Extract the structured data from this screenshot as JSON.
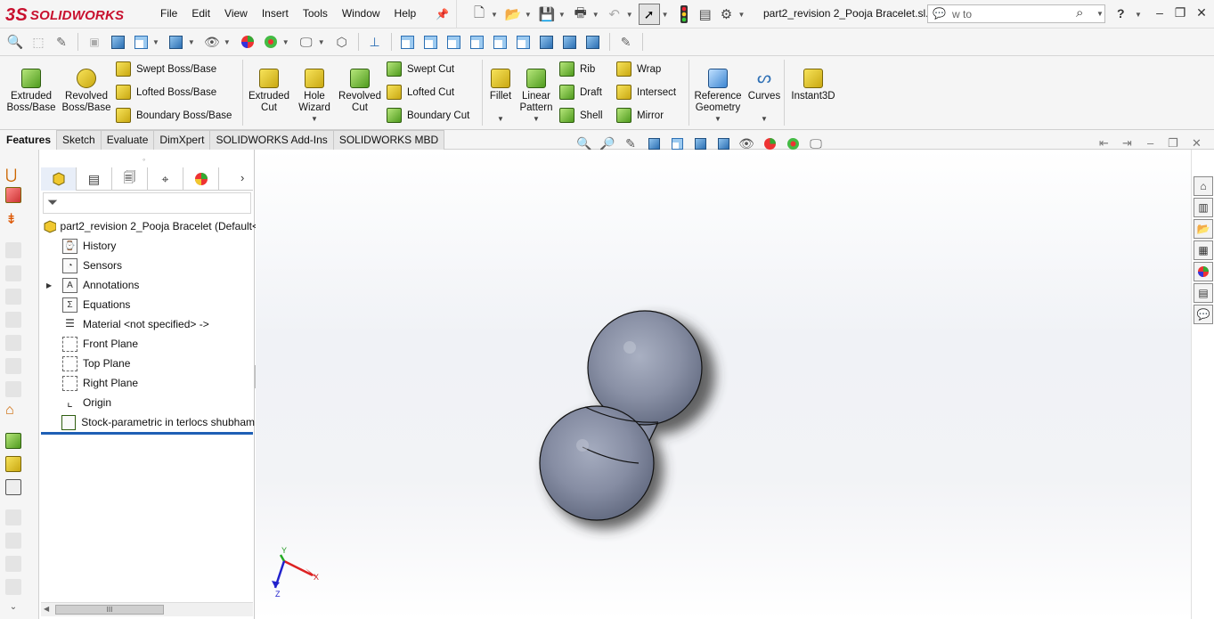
{
  "app": {
    "logo_prefix": "3S",
    "logo_text": "SOLIDWORKS"
  },
  "menu": [
    "File",
    "Edit",
    "View",
    "Insert",
    "Tools",
    "Window",
    "Help"
  ],
  "document_title": "part2_revision 2_Pooja Bracelet.sl...",
  "search": {
    "value": "w to"
  },
  "help_label": "?",
  "ribbon": {
    "extruded_boss": "Extruded Boss/Base",
    "revolved_boss": "Revolved Boss/Base",
    "swept_boss": "Swept Boss/Base",
    "lofted_boss": "Lofted Boss/Base",
    "boundary_boss": "Boundary Boss/Base",
    "extruded_cut": "Extruded Cut",
    "hole_wizard": "Hole Wizard",
    "revolved_cut": "Revolved Cut",
    "swept_cut": "Swept Cut",
    "lofted_cut": "Lofted Cut",
    "boundary_cut": "Boundary Cut",
    "fillet": "Fillet",
    "linear_pattern": "Linear Pattern",
    "rib": "Rib",
    "draft": "Draft",
    "shell": "Shell",
    "wrap": "Wrap",
    "intersect": "Intersect",
    "mirror": "Mirror",
    "reference_geometry": "Reference Geometry",
    "curves": "Curves",
    "instant3d": "Instant3D"
  },
  "tabs": [
    {
      "label": "Features",
      "active": true
    },
    {
      "label": "Sketch",
      "active": false
    },
    {
      "label": "Evaluate",
      "active": false
    },
    {
      "label": "DimXpert",
      "active": false
    },
    {
      "label": "SOLIDWORKS Add-Ins",
      "active": false
    },
    {
      "label": "SOLIDWORKS MBD",
      "active": false
    }
  ],
  "feature_tree": {
    "root": "part2_revision 2_Pooja Bracelet  (Default<",
    "items": [
      {
        "label": "History",
        "icon": "history-icon",
        "expandable": false
      },
      {
        "label": "Sensors",
        "icon": "sensors-icon",
        "expandable": false
      },
      {
        "label": "Annotations",
        "icon": "annotations-icon",
        "expandable": true
      },
      {
        "label": "Equations",
        "icon": "equations-icon",
        "expandable": false
      },
      {
        "label": "Material <not specified> ->",
        "icon": "material-icon",
        "expandable": false
      },
      {
        "label": "Front Plane",
        "icon": "plane-icon",
        "expandable": false
      },
      {
        "label": "Top Plane",
        "icon": "plane-icon",
        "expandable": false
      },
      {
        "label": "Right Plane",
        "icon": "plane-icon",
        "expandable": false
      },
      {
        "label": "Origin",
        "icon": "origin-icon",
        "expandable": false
      },
      {
        "label": "Stock-parametric in terlocs shubham",
        "icon": "stock-feature-icon",
        "expandable": false
      }
    ],
    "scrollbar_thumb": "III"
  },
  "triad": {
    "x_label": "X",
    "y_label": "Y",
    "z_label": "Z"
  },
  "colors": {
    "accent": "#c8102e",
    "selection": "#1e5fb5",
    "model": "#8a93a8"
  }
}
